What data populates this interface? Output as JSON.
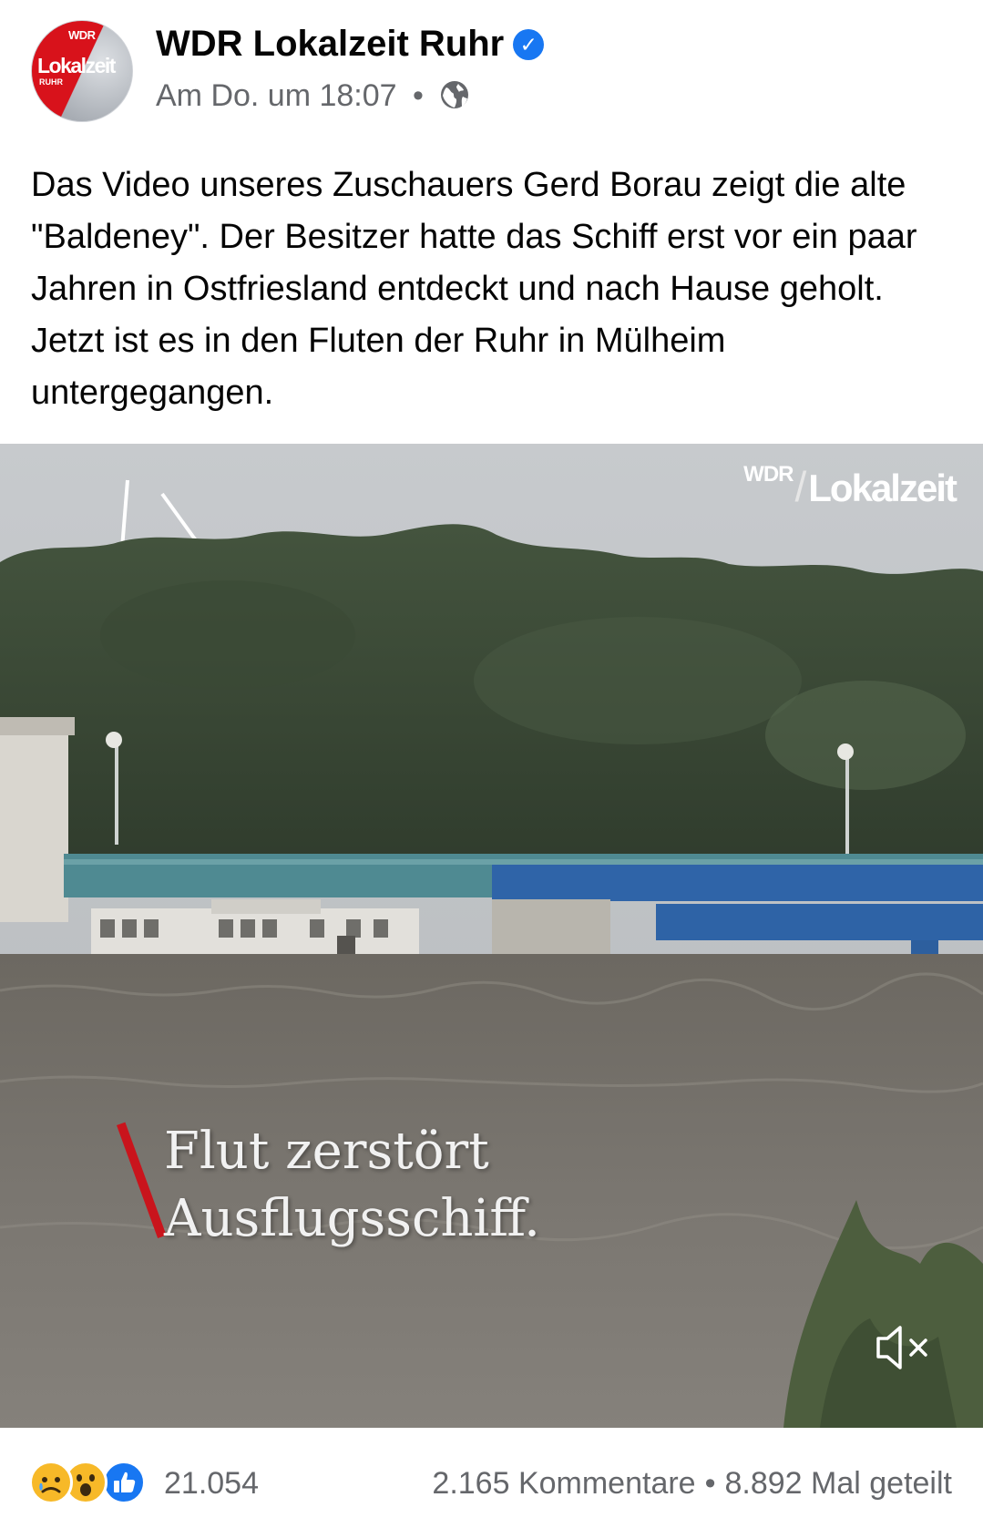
{
  "post": {
    "page_name": "WDR Lokalzeit Ruhr",
    "timestamp": "Am Do. um 18:07",
    "separator": "•",
    "privacy_icon": "globe-icon",
    "text": "Das Video unseres Zuschauers Gerd Borau zeigt die alte \"Baldeney\". Der Besitzer hatte das Schiff erst vor ein paar Jahren in Ostfriesland entdeckt und nach Hause geholt. Jetzt ist es in den Fluten der Ruhr in Mülheim untergegangen.",
    "avatar": {
      "brand": "WDR",
      "title": "Lokalzeit",
      "region": "RUHR"
    }
  },
  "video": {
    "watermark_brand": "WDR",
    "watermark_slash": "/",
    "watermark_title": "Lokalzeit",
    "caption_line1": "Flut zerstört",
    "caption_line2": "Ausflugsschiff.",
    "mute_icon": "speaker-muted-icon"
  },
  "footer": {
    "reactions": [
      "sad",
      "wow",
      "like"
    ],
    "reaction_count": "21.054",
    "comments": "2.165 Kommentare",
    "separator": "•",
    "shares": "8.892 Mal geteilt"
  },
  "colors": {
    "brand_blue": "#1877f2",
    "wdr_red": "#d8121b",
    "meta_grey": "#65676b"
  }
}
